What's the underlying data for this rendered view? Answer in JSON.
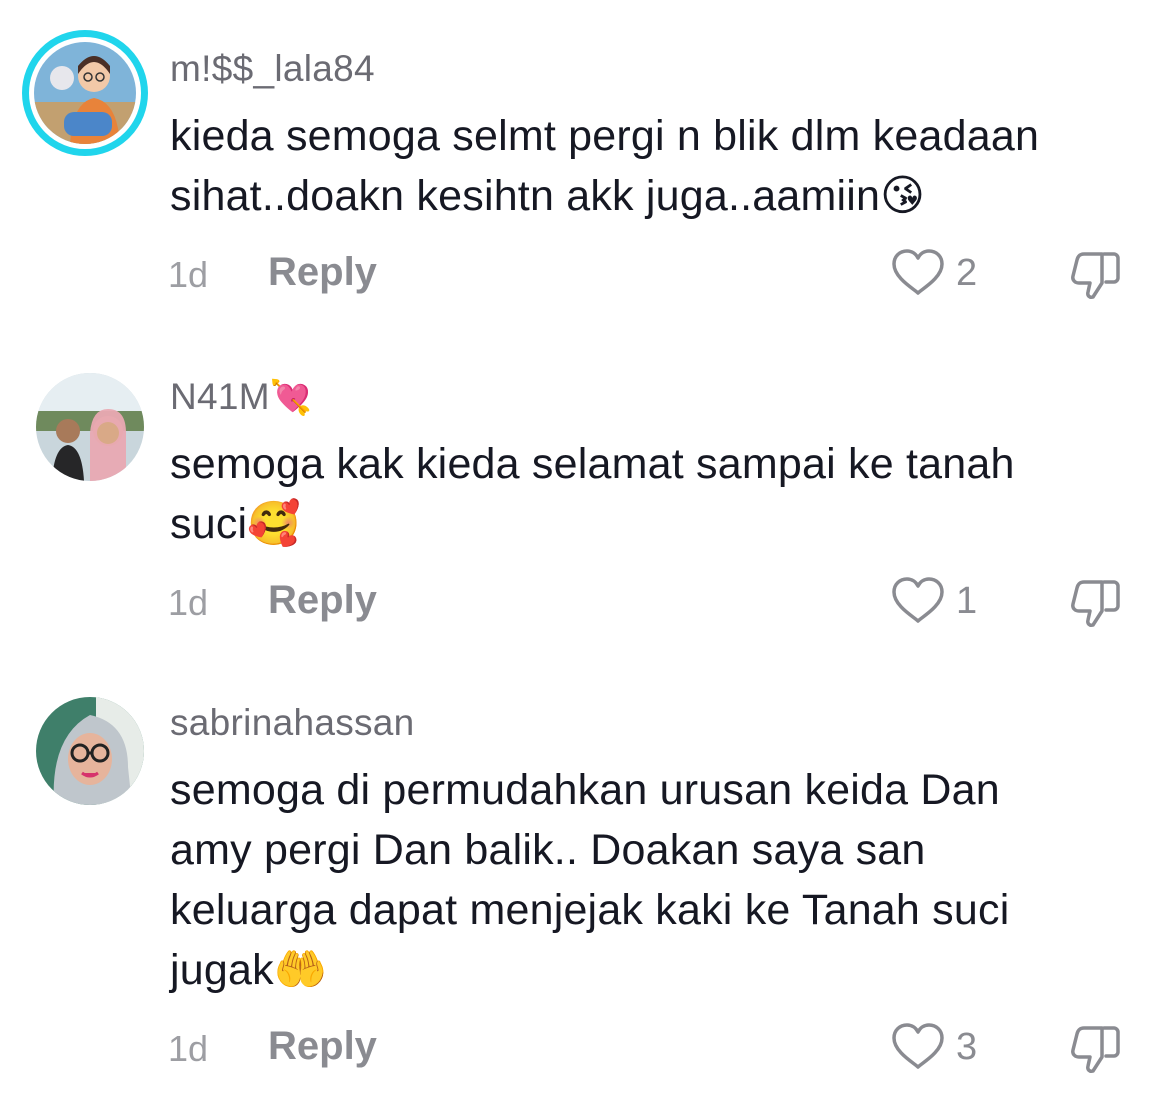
{
  "comments": [
    {
      "username": "m!$$_lala84",
      "username_emoji": "",
      "lines": [
        "kieda semoga selmt pergi n blik dlm keadaan",
        "sihat..doakn kesihtn akk juga..aamiin"
      ],
      "trailing_emoji": "😘",
      "time": "1d",
      "reply_label": "Reply",
      "likes": "2",
      "avatar_icon": "avatar-cartoon-girl-with-cat",
      "avatar_ring_color": "#20d5ec"
    },
    {
      "username": "N41M",
      "username_emoji": "💘",
      "lines": [
        "semoga kak kieda selamat sampai ke tanah",
        "suci"
      ],
      "trailing_emoji": "🥰",
      "time": "1d",
      "reply_label": "Reply",
      "likes": "1",
      "avatar_icon": "avatar-photo-two-people"
    },
    {
      "username": "sabrinahassan",
      "username_emoji": "",
      "lines": [
        "semoga di permudahkan urusan keida Dan",
        "amy pergi Dan balik.. Doakan saya san",
        "keluarga dapat menjejak kaki ke Tanah suci",
        "jugak"
      ],
      "trailing_emoji": "🤲",
      "time": "1d",
      "reply_label": "Reply",
      "likes": "3",
      "avatar_icon": "avatar-photo-woman-hijab-glasses"
    }
  ],
  "icons": {
    "like": "heart-outline-icon",
    "dislike": "thumbs-down-outline-icon"
  },
  "colors": {
    "text": "#161823",
    "secondary": "#8a8b91",
    "username": "#6b6b73"
  }
}
